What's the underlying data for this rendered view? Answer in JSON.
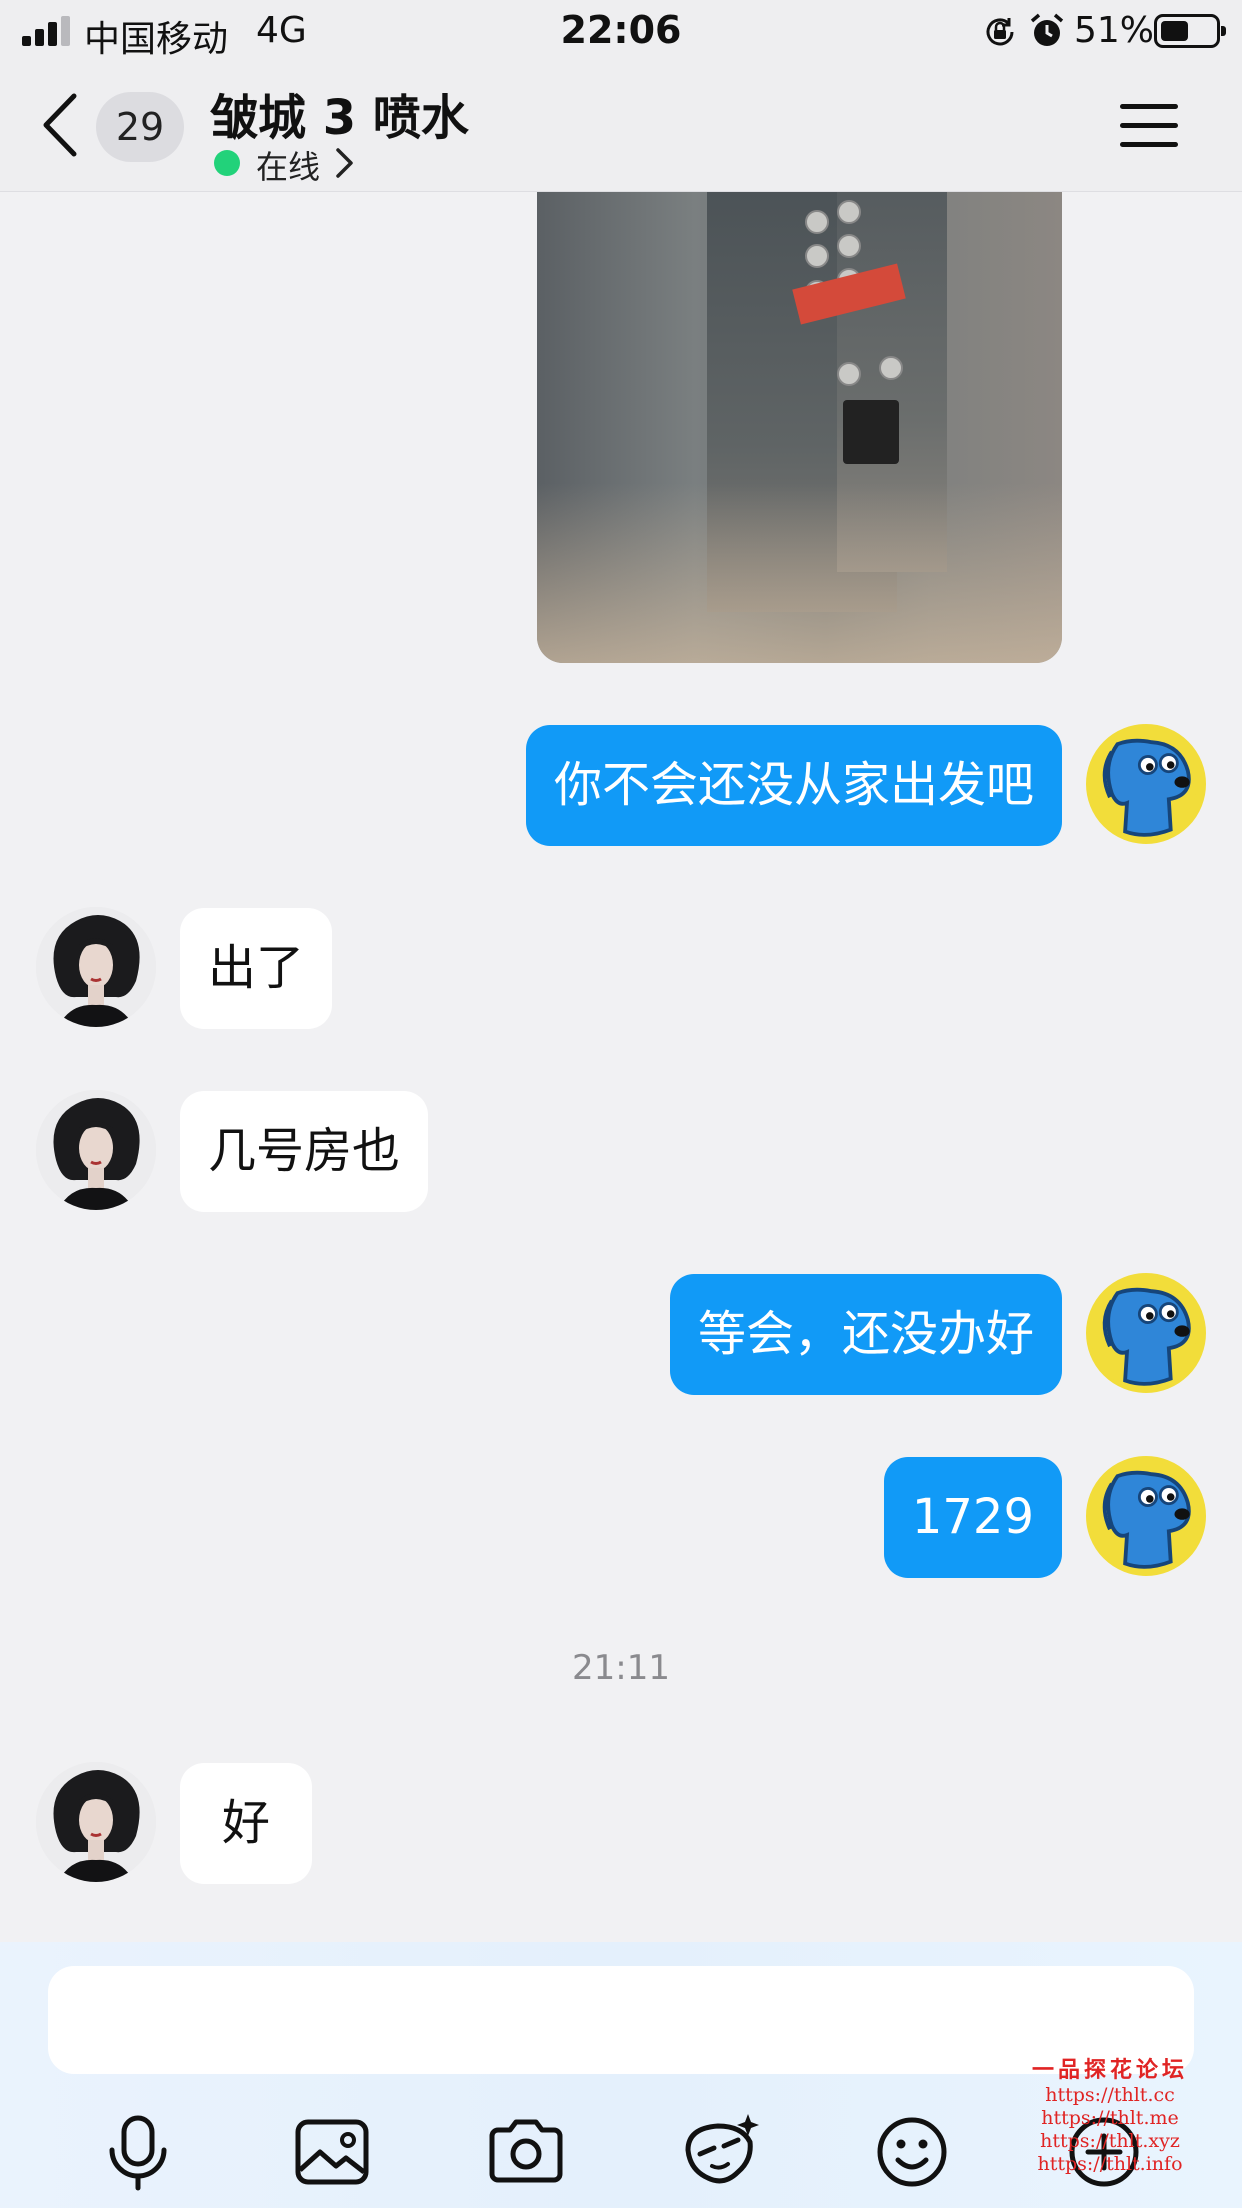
{
  "status_bar": {
    "carrier": "中国移动",
    "network": "4G",
    "time": "22:06",
    "battery_percent": "51%",
    "battery_level": 0.51,
    "signal_bars": 3
  },
  "header": {
    "unread_count": "29",
    "title": "皱城 3 喷水",
    "presence": "在线",
    "presence_color": "#22d27a",
    "icons": {
      "back": "chevron-left-icon",
      "menu": "hamburger-menu-icon"
    }
  },
  "messages": [
    {
      "from": "me",
      "type": "image",
      "content": "elevator-photo"
    },
    {
      "from": "me",
      "type": "text",
      "text": "你不会还没从家出发吧"
    },
    {
      "from": "her",
      "type": "text",
      "text": "出了"
    },
    {
      "from": "her",
      "type": "text",
      "text": "几号房也"
    },
    {
      "from": "me",
      "type": "text",
      "text": "等会，还没办好"
    },
    {
      "from": "me",
      "type": "text",
      "text": "1729"
    },
    {
      "from": "system",
      "type": "timestamp",
      "text": "21:11"
    },
    {
      "from": "her",
      "type": "text",
      "text": "好"
    }
  ],
  "input": {
    "placeholder": "",
    "value": ""
  },
  "toolbar": [
    "mic-icon",
    "image-icon",
    "camera-icon",
    "sticker-icon",
    "emoji-icon",
    "plus-icon"
  ],
  "colors": {
    "outgoing_bubble": "#119af7",
    "incoming_bubble": "#ffffff",
    "background": "#f1f1f3"
  },
  "watermark": {
    "title": "一品探花论坛",
    "lines": [
      "https://thlt.cc",
      "https://thlt.me",
      "https://thlt.xyz",
      "https://thlt.info"
    ]
  }
}
